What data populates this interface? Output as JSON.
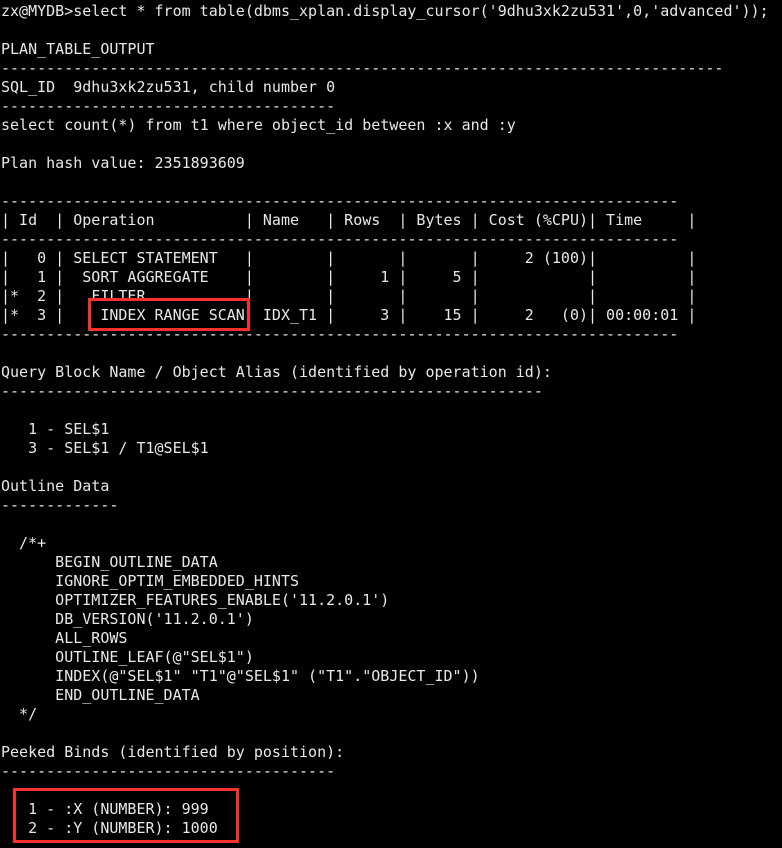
{
  "terminal": {
    "prompt_line": "zx@MYDB>select * from table(dbms_xplan.display_cursor('9dhu3xk2zu531',0,'advanced'));",
    "background_color": "#000000",
    "foreground_color": "#e8e8e8",
    "highlight_color": "#f8312a",
    "column_header": "PLAN_TABLE_OUTPUT",
    "sql_id_line": "SQL_ID  9dhu3xk2zu531, child number 0",
    "statement": "select count(*) from t1 where object_id between :x and :y",
    "plan_hash_line": "Plan hash value: 2351893609",
    "sql_id": "9dhu3xk2zu531",
    "child_number": "0",
    "plan_hash_value": "2351893609"
  },
  "plan_table": {
    "columns": [
      "Id",
      "Operation",
      "Name",
      "Rows",
      "Bytes",
      "Cost (%CPU)",
      "Time"
    ],
    "header_line": "| Id  | Operation          | Name   | Rows  | Bytes | Cost (%CPU)| Time     |",
    "separator": "---------------------------------------------------------------------------",
    "rows": [
      {
        "id": "0",
        "star": "",
        "operation": "SELECT STATEMENT",
        "name": "",
        "rows": "",
        "bytes": "",
        "cost": "2 (100)",
        "time": ""
      },
      {
        "id": "1",
        "star": "",
        "operation": "SORT AGGREGATE",
        "name": "",
        "rows": "1",
        "bytes": "5",
        "cost": "",
        "time": ""
      },
      {
        "id": "2",
        "star": "*",
        "operation": "FILTER",
        "name": "",
        "rows": "",
        "bytes": "",
        "cost": "",
        "time": ""
      },
      {
        "id": "3",
        "star": "*",
        "operation": "INDEX RANGE SCAN",
        "name": "IDX_T1",
        "rows": "3",
        "bytes": "15",
        "cost": "2   (0)",
        "time": "00:00:01"
      }
    ]
  },
  "query_block": {
    "heading": "Query Block Name / Object Alias (identified by operation id):",
    "separator": "------------------------------------------------------------",
    "entries": [
      "1 - SEL$1",
      "3 - SEL$1 / T1@SEL$1"
    ]
  },
  "outline_data": {
    "heading": "Outline Data",
    "separator": "-------------",
    "open_comment": "/*+",
    "close_comment": "*/",
    "hints": [
      "BEGIN_OUTLINE_DATA",
      "IGNORE_OPTIM_EMBEDDED_HINTS",
      "OPTIMIZER_FEATURES_ENABLE('11.2.0.1')",
      "DB_VERSION('11.2.0.1')",
      "ALL_ROWS",
      "OUTLINE_LEAF(@\"SEL$1\")",
      "INDEX(@\"SEL$1\" \"T1\"@\"SEL$1\" (\"T1\".\"OBJECT_ID\"))",
      "END_OUTLINE_DATA"
    ]
  },
  "peeked_binds": {
    "heading": "Peeked Binds (identified by position):",
    "separator": "-------------------------------------",
    "binds": [
      {
        "position": "1",
        "name": ":X",
        "datatype": "NUMBER",
        "value": "999",
        "line": "1 - :X (NUMBER): 999"
      },
      {
        "position": "2",
        "name": ":Y",
        "datatype": "NUMBER",
        "value": "1000",
        "line": "2 - :Y (NUMBER): 1000"
      }
    ]
  },
  "full_text": "zx@MYDB>select * from table(dbms_xplan.display_cursor('9dhu3xk2zu531',0,'advanced'));\n\nPLAN_TABLE_OUTPUT\n--------------------------------------------------------------------------------\nSQL_ID  9dhu3xk2zu531, child number 0\n-------------------------------------\nselect count(*) from t1 where object_id between :x and :y\n\nPlan hash value: 2351893609\n\n---------------------------------------------------------------------------\n| Id  | Operation          | Name   | Rows  | Bytes | Cost (%CPU)| Time     |\n---------------------------------------------------------------------------\n|   0 | SELECT STATEMENT   |        |       |       |     2 (100)|          |\n|   1 |  SORT AGGREGATE    |        |     1 |     5 |            |          |\n|*  2 |   FILTER           |        |       |       |            |          |\n|*  3 |    INDEX RANGE SCAN| IDX_T1 |     3 |    15 |     2   (0)| 00:00:01 |\n---------------------------------------------------------------------------\n\nQuery Block Name / Object Alias (identified by operation id):\n------------------------------------------------------------\n\n   1 - SEL$1\n   3 - SEL$1 / T1@SEL$1\n\nOutline Data\n-------------\n\n  /*+\n      BEGIN_OUTLINE_DATA\n      IGNORE_OPTIM_EMBEDDED_HINTS\n      OPTIMIZER_FEATURES_ENABLE('11.2.0.1')\n      DB_VERSION('11.2.0.1')\n      ALL_ROWS\n      OUTLINE_LEAF(@\"SEL$1\")\n      INDEX(@\"SEL$1\" \"T1\"@\"SEL$1\" (\"T1\".\"OBJECT_ID\"))\n      END_OUTLINE_DATA\n  */\n\nPeeked Binds (identified by position):\n-------------------------------------\n\n   1 - :X (NUMBER): 999\n   2 - :Y (NUMBER): 1000",
  "annotations": {
    "highlight_operation": "INDEX RANGE SCAN",
    "highlight_binds": "1 - :X (NUMBER): 999 / 2 - :Y (NUMBER): 1000"
  }
}
